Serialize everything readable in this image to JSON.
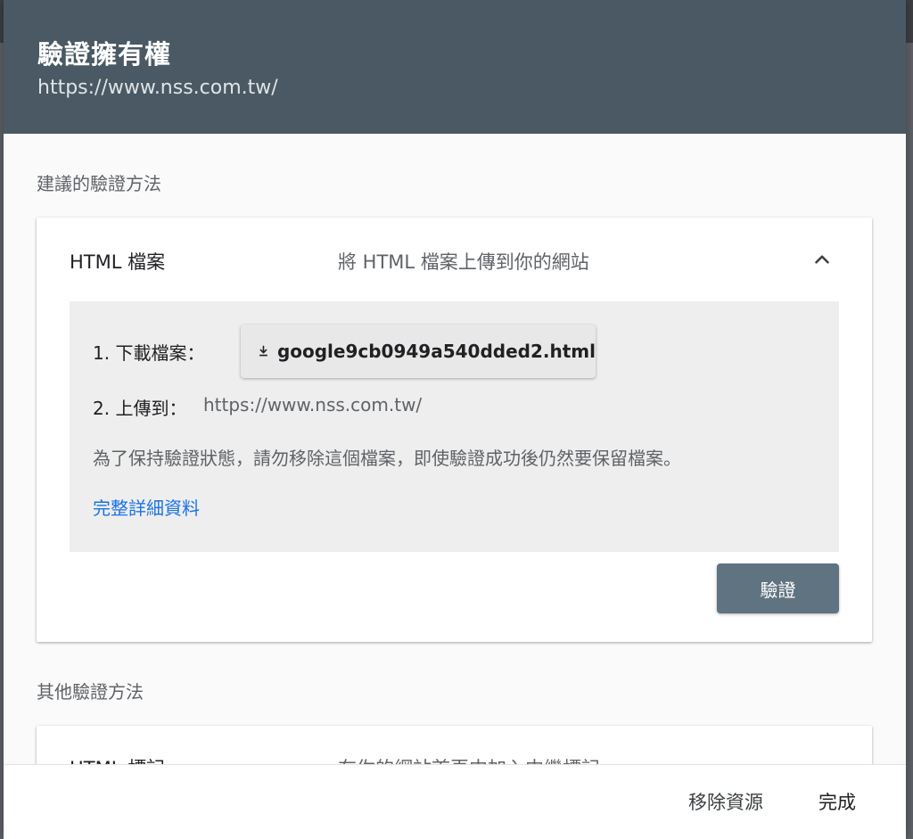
{
  "dialog": {
    "title": "驗證擁有權",
    "subtitle": "https://www.nss.com.tw/"
  },
  "recommended": {
    "heading": "建議的驗證方法",
    "method": {
      "name": "HTML 檔案",
      "description": "將 HTML 檔案上傳到你的網站",
      "expanded": true,
      "step1_label": "1. 下載檔案：",
      "download_filename": "google9cb0949a540dded2.html",
      "step2_label": "2. 上傳到：",
      "upload_url": "https://www.nss.com.tw/",
      "note": "為了保持驗證狀態，請勿移除這個檔案，即使驗證成功後仍然要保留檔案。",
      "details_link": "完整詳細資料",
      "verify_label": "驗證"
    }
  },
  "other": {
    "heading": "其他驗證方法",
    "method": {
      "name": "HTML 標記",
      "description": "在你的網站首頁中加入中繼標記"
    }
  },
  "footer": {
    "remove_label": "移除資源",
    "done_label": "完成"
  },
  "colors": {
    "header_bg": "#4a5963",
    "link": "#1a73e8",
    "verify_button": "#607380"
  }
}
